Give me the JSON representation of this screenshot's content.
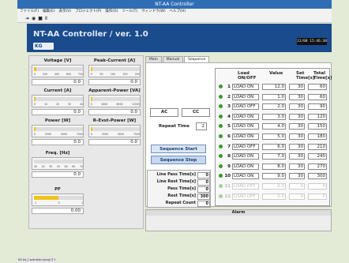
{
  "window": {
    "title": "NT-AA Controller"
  },
  "menu": [
    "ファイル(F)",
    "編集(E)",
    "表示(V)",
    "プロジェクト(P)",
    "操作(O)",
    "ツール(T)",
    "ウィンドウ(W)",
    "ヘルプ(H)"
  ],
  "toolbar": {
    "icons": [
      "run-arrow-icon",
      "stop-icon",
      "pause-icon",
      "abort-icon"
    ],
    "glyphs": [
      "➜",
      "◉",
      "■",
      "Ⅱ"
    ]
  },
  "header": {
    "title": "NT-AA Controller / ver. 1.0",
    "logo": "KG",
    "clock": "12/08 15:46:30"
  },
  "meters": [
    {
      "label": "Voltage [V]",
      "value": "0.0",
      "level": 0.05,
      "ticks": [
        "0",
        "200",
        "400",
        "600",
        "720"
      ]
    },
    {
      "label": "Peak-Current [A]",
      "value": "0.0",
      "level": 0.03,
      "ticks": [
        "0",
        "50",
        "100",
        "150",
        "200"
      ]
    },
    {
      "label": "Current [A]",
      "value": "0.0",
      "level": 0.03,
      "ticks": [
        "0",
        "10",
        "20",
        "30",
        "40"
      ]
    },
    {
      "label": "Apparent-Power [VA]",
      "value": "0.0",
      "level": 0.03,
      "ticks": [
        "0",
        "4000",
        "8000",
        "12000"
      ]
    },
    {
      "label": "Power [W]",
      "value": "0.0",
      "level": 0.03,
      "ticks": [
        "0",
        "2500",
        "5000",
        "7500"
      ]
    },
    {
      "label": "R-Evst-Power [W]",
      "value": "0.0",
      "level": 0.03,
      "ticks": [
        "0",
        "2500",
        "5000",
        "7500"
      ]
    },
    {
      "label": "Freq. [Hz]",
      "value": "0.0",
      "level": 0.0,
      "ticks": [
        "40",
        "45",
        "50",
        "55",
        "60",
        "65",
        "70"
      ]
    },
    {
      "label": "PF",
      "value": "0.00",
      "level": 0.5,
      "ticks": [
        "-1",
        "0",
        "1"
      ]
    }
  ],
  "tabs": [
    "Main",
    "Manual",
    "Sequence"
  ],
  "sequence": {
    "ac_label": "AC",
    "cc_label": "CC",
    "repeat_time_label": "Repeat Time",
    "repeat_time_value": "2",
    "start_button": "Sequence Start",
    "stop_button": "Sequence Stop"
  },
  "stats": [
    {
      "label": "Line Pass Time[s]",
      "value": "0"
    },
    {
      "label": "Line Rest Time[s]",
      "value": "0"
    },
    {
      "label": "Pass Time[s]",
      "value": "0"
    },
    {
      "label": "Rest Time[s]",
      "value": "300"
    },
    {
      "label": "Repeat Count",
      "value": "0"
    }
  ],
  "steps_header": {
    "state": "Load ON/OFF",
    "value": "Value",
    "set": "Set Time[s]",
    "total": "Total Time[s]"
  },
  "steps": [
    {
      "n": "1",
      "state": "LOAD ON",
      "value": "12.0",
      "set": "30",
      "total": "60",
      "enabled": true
    },
    {
      "n": "2",
      "state": "LOAD ON",
      "value": "1.0",
      "set": "30",
      "total": "60",
      "enabled": true
    },
    {
      "n": "3",
      "state": "LOAD OFF",
      "value": "2.0",
      "set": "30",
      "total": "90",
      "enabled": true
    },
    {
      "n": "4",
      "state": "LOAD ON",
      "value": "3.0",
      "set": "30",
      "total": "120",
      "enabled": true
    },
    {
      "n": "5",
      "state": "LOAD ON",
      "value": "4.0",
      "set": "30",
      "total": "150",
      "enabled": true
    },
    {
      "n": "6",
      "state": "LOAD ON",
      "value": "5.0",
      "set": "30",
      "total": "180",
      "enabled": true
    },
    {
      "n": "7",
      "state": "LOAD OFF",
      "value": "6.0",
      "set": "30",
      "total": "210",
      "enabled": true
    },
    {
      "n": "8",
      "state": "LOAD ON",
      "value": "7.0",
      "set": "30",
      "total": "240",
      "enabled": true
    },
    {
      "n": "9",
      "state": "LOAD ON",
      "value": "8.0",
      "set": "30",
      "total": "270",
      "enabled": true
    },
    {
      "n": "10",
      "state": "LOAD ON",
      "value": "9.0",
      "set": "30",
      "total": "300",
      "enabled": true
    },
    {
      "n": "11",
      "state": "LOAD OFF",
      "value": "0.0",
      "set": "0",
      "total": "0",
      "enabled": false
    },
    {
      "n": "12",
      "state": "LOAD OFF",
      "value": "0.0",
      "set": "0",
      "total": "0",
      "enabled": false
    }
  ],
  "alarm": {
    "title": "Alarm"
  },
  "statusbar": {
    "text": "NT-AA_Controller.lvproj/マイ コンピュータ"
  }
}
